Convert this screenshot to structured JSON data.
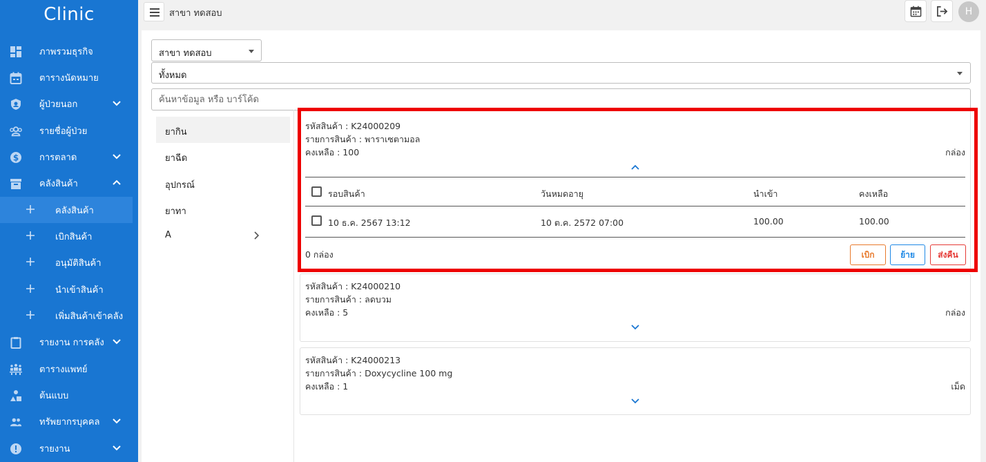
{
  "app": {
    "brand": "Clinic"
  },
  "sidebar": {
    "items": [
      {
        "label": "ภาพรวมธุรกิจ",
        "icon": "dashboard-icon"
      },
      {
        "label": "ตารางนัดหมาย",
        "icon": "calendar-icon"
      },
      {
        "label": "ผู้ป่วยนอก",
        "icon": "shield-icon",
        "expand": "chevron-down"
      },
      {
        "label": "รายชื่อผู้ป่วย",
        "icon": "people-group-icon"
      },
      {
        "label": "การตลาด",
        "icon": "dollar-icon",
        "expand": "chevron-down"
      },
      {
        "label": "คลังสินค้า",
        "icon": "archive-icon",
        "expand": "chevron-up",
        "active": true
      },
      {
        "label": "รายงาน การคลัง",
        "icon": "clipboard-icon",
        "expand": "chevron-down"
      },
      {
        "label": "ตารางแพทย์",
        "icon": "doctor-schedule-icon"
      },
      {
        "label": "ต้นแบบ",
        "icon": "shapes-icon"
      },
      {
        "label": "ทรัพยากรบุคคล",
        "icon": "people-icon",
        "expand": "chevron-down"
      },
      {
        "label": "รายงาน",
        "icon": "alert-icon",
        "expand": "chevron-down"
      }
    ],
    "subitems": [
      {
        "label": "คลังสินค้า",
        "active": true
      },
      {
        "label": "เบิกสินค้า"
      },
      {
        "label": "อนุมัติสินค้า"
      },
      {
        "label": "นำเข้าสินค้า"
      },
      {
        "label": "เพิ่มสินค้าเข้าคลัง"
      }
    ]
  },
  "header": {
    "branch_title": "สาขา ทดสอบ",
    "avatar_initial": "H"
  },
  "filters": {
    "branch_select": "สาขา ทดสอบ",
    "type_select": "ทั้งหมด",
    "search_placeholder": "ค้นหาข้อมูล หรือ บาร์โค้ด"
  },
  "categories": [
    "ยากิน",
    "ยาฉีด",
    "อุปกรณ์",
    "ยาทา",
    "A"
  ],
  "products": [
    {
      "code": "รหัสสินค้า : K24000209",
      "name": "รายการสินค้า : พาราเซตามอล",
      "remaining": "คงเหลือ : 100",
      "unit": "กล่อง",
      "expanded": true,
      "table": {
        "headers": [
          "รอบสินค้า",
          "วันหมดอายุ",
          "นำเข้า",
          "คงเหลือ"
        ],
        "rows": [
          [
            "10 ธ.ค. 2567 13:12",
            "10 ต.ค. 2572 07:00",
            "100.00",
            "100.00"
          ]
        ]
      },
      "selected_total": "0 กล่อง",
      "actions": {
        "withdraw": "เบิก",
        "move": "ย้าย",
        "return": "ส่งคืน"
      }
    },
    {
      "code": "รหัสสินค้า : K24000210",
      "name": "รายการสินค้า : ลดบวม",
      "remaining": "คงเหลือ : 5",
      "unit": "กล่อง",
      "expanded": false
    },
    {
      "code": "รหัสสินค้า : K24000213",
      "name": "รายการสินค้า : Doxycycline 100 mg",
      "remaining": "คงเหลือ : 1",
      "unit": "เม็ด",
      "expanded": false
    }
  ],
  "colors": {
    "sidebar": "#1976d2",
    "withdraw": "#e8792b",
    "move": "#1e88e5",
    "return": "#e53935",
    "highlight": "#ee0000"
  }
}
